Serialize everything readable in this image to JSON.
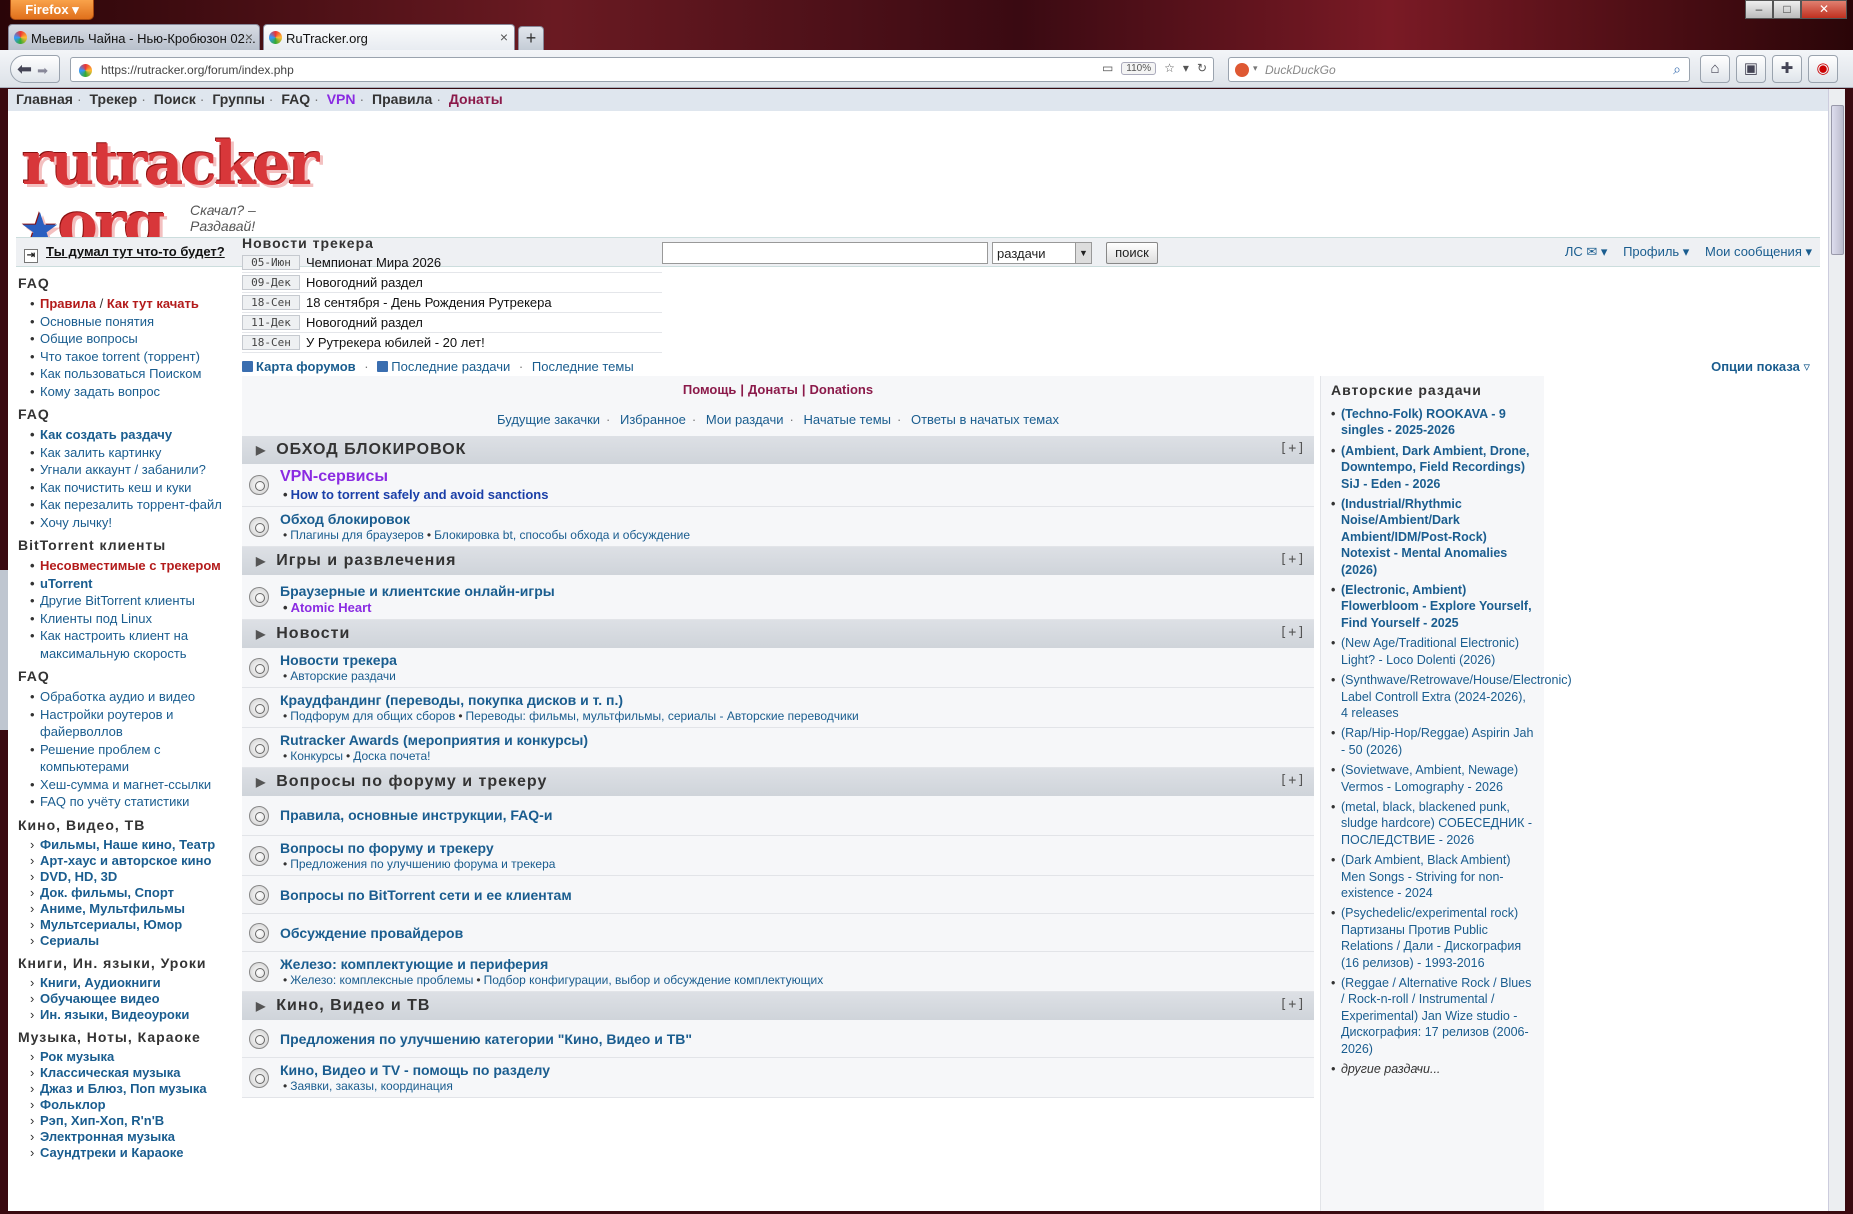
{
  "browser": {
    "menu_button": "Firefox",
    "tabs": [
      {
        "title": "Мьевиль Чайна - Нью-Кробюзон 02..."
      },
      {
        "title": "RuTracker.org"
      }
    ],
    "url": "https://rutracker.org/forum/index.php",
    "zoom": "110%",
    "search_placeholder": "DuckDuckGo"
  },
  "topmenu": {
    "home": "Главная",
    "tracker": "Трекер",
    "search": "Поиск",
    "groups": "Группы",
    "faq": "FAQ",
    "vpn": "VPN",
    "rules": "Правила",
    "donate": "Донаты"
  },
  "logo": {
    "wordmark": "rutracker",
    "wordmark_end": "org",
    "tagline": "Скачал? – Раздавай!"
  },
  "loginbar": {
    "question": "Ты думал тут что-то будет?",
    "search_value": "",
    "search_select": "раздачи",
    "search_button": "поиск",
    "pm": "ЛС ✉ ▾",
    "profile": "Профиль ▾",
    "my_posts": "Мои сообщения ▾"
  },
  "sidebar": {
    "faq1_title": "FAQ",
    "faq1_rules": "Правила",
    "faq1_slash": " / ",
    "faq1_start": "Как тут качать",
    "faq1_items": [
      "Основные понятия",
      "Общие вопросы",
      "Что такое torrent (торрент)",
      "Как пользоваться Поиском",
      "Кому задать вопрос"
    ],
    "faq2_title": "FAQ",
    "faq2_first": "Как создать раздачу",
    "faq2_items": [
      "Как залить картинку",
      "Угнали аккаунт / забанили?",
      "Как почистить кеш и куки",
      "Как перезалить торрент-файл",
      "Хочу лычку!"
    ],
    "bt_title": "BitTorrent клиенты",
    "bt_incompat": "Несовместимые с трекером",
    "bt_utorrent": "uTorrent",
    "bt_items": [
      "Другие BitTorrent клиенты",
      "Клиенты под Linux",
      "Как настроить клиент на максимальную скорость"
    ],
    "faq3_title": "FAQ",
    "faq3_items": [
      "Обработка аудио и видео",
      "Настройки роутеров и файерволлов",
      "Решение проблем с компьютерами",
      "Хеш-сумма и магнет-ссылки",
      "FAQ по учёту статистики"
    ],
    "kino_title": "Кино, Видео, ТВ",
    "kino_items": [
      "Фильмы, Наше кино, Театр",
      "Арт-хаус и авторское кино",
      "DVD, HD, 3D",
      "Док. фильмы, Спорт",
      "Аниме, Мультфильмы",
      "Мультсериалы, Юмор",
      "Сериалы"
    ],
    "books_title": "Книги, Ин. языки, Уроки",
    "books_items": [
      "Книги, Аудиокниги",
      "Обучающее видео",
      "Ин. языки, Видеоуроки"
    ],
    "music_title": "Музыка, Ноты, Караоке",
    "music_items": [
      "Рок музыка",
      "Классическая музыка",
      "Джаз и Блюз, Поп музыка",
      "Фольклор",
      "Рэп, Хип-Хоп, R'n'B",
      "Электронная музыка",
      "Саундтреки и Караоке"
    ]
  },
  "news": {
    "title": "Новости трекера",
    "items": [
      {
        "date": "05-Июн",
        "text": "Чемпионат Мира 2026"
      },
      {
        "date": "09-Дек",
        "text": "Новогодний раздел"
      },
      {
        "date": "18-Сен",
        "text": "18 сентября - День Рождения Рутрекера"
      },
      {
        "date": "11-Дек",
        "text": "Новогодний раздел"
      },
      {
        "date": "18-Сен",
        "text": "У Рутрекера юбилей - 20 лет!"
      }
    ]
  },
  "links": {
    "map": "Карта форумов",
    "latest_releases": "Последние раздачи",
    "latest_topics": "Последние темы",
    "options": "Опции показа"
  },
  "helpbar": {
    "help": "Помощь",
    "donate": "Донаты",
    "donations": "Donations"
  },
  "quicklinks": [
    "Будущие закачки",
    "Избранное",
    "Мои раздачи",
    "Начатые темы",
    "Ответы в начатых темах"
  ],
  "categories": {
    "c1": "ОБХОД БЛОКИРОВОК",
    "c2": "Игры и развлечения",
    "c3": "Новости",
    "c4": "Вопросы по форуму и трекеру",
    "c5": "Кино, Видео и ТВ",
    "plus": "[+]"
  },
  "forums": {
    "vpn_title": "VPN-сервисы",
    "vpn_sub": "How to torrent safely and avoid sanctions",
    "block_title": "Обход блокировок",
    "block_sub1": "Плагины для браузеров",
    "block_sub2": "Блокировка bt, способы обхода и обсуждение",
    "games_title": "Браузерные и клиентские онлайн-игры",
    "games_sub": "Atomic Heart",
    "news_title": "Новости трекера",
    "news_sub": "Авторские раздачи",
    "crowd_title": "Краудфандинг (переводы, покупка дисков и т. п.)",
    "crowd_sub1": "Подфорум для общих сборов",
    "crowd_sub2": "Переводы: фильмы, мультфильмы, сериалы - Авторские переводчики",
    "awards_title": "Rutracker Awards (мероприятия и конкурсы)",
    "awards_sub1": "Конкурсы",
    "awards_sub2": "Доска почета!",
    "rules_title": "Правила, основные инструкции, FAQ-и",
    "q_title": "Вопросы по форуму и трекеру",
    "q_sub": "Предложения по улучшению форума и трекера",
    "bt_title": "Вопросы по BitTorrent сети и ее клиентам",
    "prov_title": "Обсуждение провайдеров",
    "hw_title": "Железо: комплектующие и периферия",
    "hw_sub1": "Железо: комплексные проблемы",
    "hw_sub2": "Подбор конфигурации, выбор и обсуждение комплектующих",
    "kino_sugg_title": "Предложения по улучшению категории \"Кино, Видео и ТВ\"",
    "kino_help_title": "Кино, Видео и TV - помощь по разделу",
    "kino_help_sub": "Заявки, заказы, координация"
  },
  "right_panel": {
    "title": "Авторские раздачи",
    "items": [
      {
        "text": "(Techno-Folk) ROOKAVA - 9 singles - 2025-2026",
        "bold": true
      },
      {
        "text": "(Ambient, Dark Ambient, Drone, Downtempo, Field Recordings) SiJ - Eden - 2026",
        "bold": true
      },
      {
        "text": "(Industrial/Rhythmic Noise/Ambient/Dark Ambient/IDM/Post-Rock) Notexist - Mental Anomalies (2026)",
        "bold": true
      },
      {
        "text": "(Electronic, Ambient) Flowerbloom - Explore Yourself, Find Yourself - 2025",
        "bold": true
      },
      {
        "text": "(New Age/Traditional Electronic) Light? - Loco Dolenti (2026)",
        "bold": false
      },
      {
        "text": "(Synthwave/Retrowave/House/Electronic) Label Controll Extra (2024-2026), 4 releases",
        "bold": false
      },
      {
        "text": "(Rap/Hip-Hop/Reggae) Aspirin Jah - 50 (2026)",
        "bold": false
      },
      {
        "text": "(Sovietwave, Ambient, Newage) Vermos - Lomography - 2026",
        "bold": false
      },
      {
        "text": "(metal, black, blackened punk, sludge hardcore) СОБЕСЕДНИК - ПОСЛЕДСТВИЕ - 2026",
        "bold": false
      },
      {
        "text": "(Dark Ambient, Black Ambient) Men Songs - Striving for non-existence - 2024",
        "bold": false
      },
      {
        "text": "(Psychedelic/experimental rock) Партизаны Против Public Relations / Дали - Дискография (16 релизов) - 1993-2016",
        "bold": false
      },
      {
        "text": "(Reggae / Alternative Rock / Blues / Rock-n-roll / Instrumental / Experimental) Jan Wize studio - Дискография: 17 релизов (2006-2026)",
        "bold": false
      }
    ],
    "more": "другие раздачи..."
  }
}
